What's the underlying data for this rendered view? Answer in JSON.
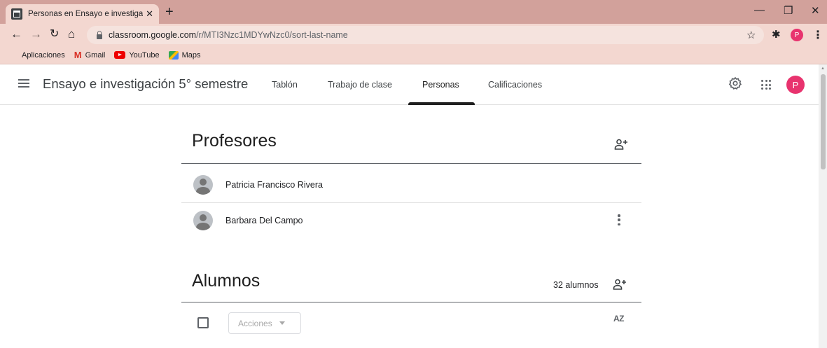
{
  "browser": {
    "tab_title": "Personas en Ensayo e investigaci",
    "tab_close": "✕",
    "new_tab": "+",
    "url_main": "classroom.google.com",
    "url_path": "/r/MTI3Nzc1MDYwNzc0/sort-last-name",
    "profile_initial": "P",
    "bookmarks": [
      {
        "label": "Aplicaciones",
        "icon": "apps-grid-icon"
      },
      {
        "label": "Gmail",
        "icon": "gmail-icon"
      },
      {
        "label": "YouTube",
        "icon": "youtube-icon"
      },
      {
        "label": "Maps",
        "icon": "maps-icon"
      }
    ]
  },
  "header": {
    "course_title": "Ensayo e investigación 5° semestre",
    "tabs": [
      {
        "label": "Tablón",
        "active": false
      },
      {
        "label": "Trabajo de clase",
        "active": false
      },
      {
        "label": "Personas",
        "active": true
      },
      {
        "label": "Calificaciones",
        "active": false
      }
    ],
    "avatar_initial": "P"
  },
  "teachers": {
    "title": "Profesores",
    "people": [
      {
        "name": "Patricia Francisco Rivera"
      },
      {
        "name": "Barbara Del Campo"
      }
    ]
  },
  "students": {
    "title": "Alumnos",
    "count_label": "32 alumnos",
    "actions_label": "Acciones",
    "sort_label": "AZ"
  },
  "colors": {
    "chrome_frame": "#d2a19b",
    "chrome_toolbar": "#f3d7d0",
    "avatar_pink": "#e8336e"
  }
}
